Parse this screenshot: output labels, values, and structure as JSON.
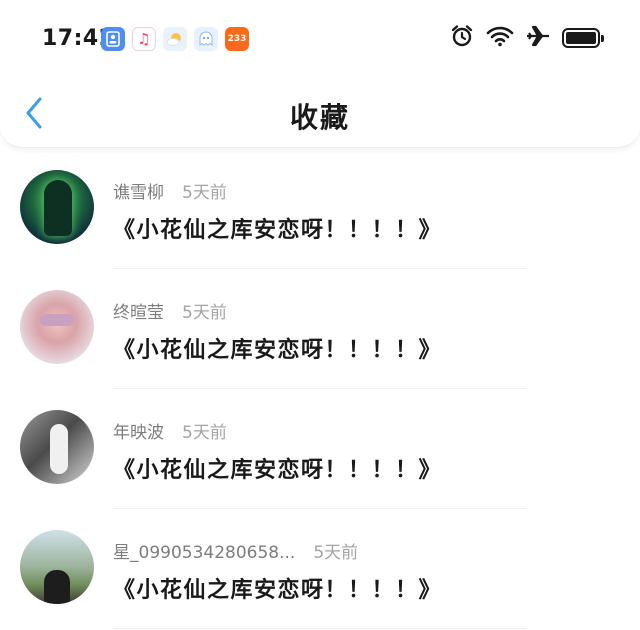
{
  "status_bar": {
    "time": "17:42",
    "badge_app_label": "233"
  },
  "header": {
    "title": "收藏"
  },
  "items": [
    {
      "username": "谯雪柳",
      "time_ago": "5天前",
      "content": "《小花仙之库安恋呀！！！！》"
    },
    {
      "username": "终暄莹",
      "time_ago": "5天前",
      "content": "《小花仙之库安恋呀！！！！》"
    },
    {
      "username": "年映波",
      "time_ago": "5天前",
      "content": "《小花仙之库安恋呀！！！！》"
    },
    {
      "username": "星_0990534280658...",
      "time_ago": "5天前",
      "content": "《小花仙之库安恋呀！！！！》"
    }
  ],
  "colors": {
    "accent": "#3a9ee8",
    "text_primary": "#1a1a1a",
    "text_secondary": "#8a8a8a"
  },
  "icons": {
    "back": "chevron-left-icon",
    "alarm": "alarm-clock-icon",
    "wifi": "wifi-icon",
    "airplane": "airplane-icon",
    "battery": "battery-icon"
  }
}
